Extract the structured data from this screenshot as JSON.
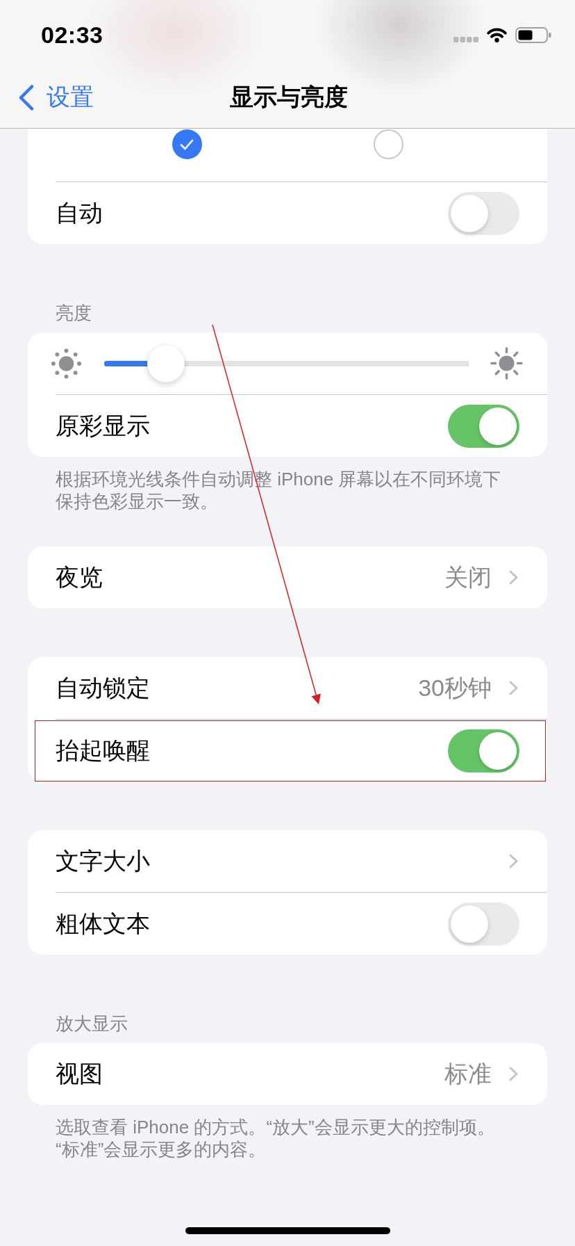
{
  "status_bar": {
    "time": "02:33"
  },
  "nav_bar": {
    "back_label": "设置",
    "title": "显示与亮度"
  },
  "groups": [
    {
      "options": [
        {
          "selected": true
        },
        {
          "selected": false
        }
      ],
      "rows": [
        {
          "kind": "toggle",
          "label": "自动",
          "on": false,
          "highlighted": false
        }
      ]
    },
    {
      "header": "亮度",
      "rows": [
        {
          "kind": "slider",
          "level": 0.17,
          "highlighted": false
        },
        {
          "kind": "toggle",
          "label": "原彩显示",
          "on": true,
          "highlighted": false
        }
      ],
      "footer": [
        "根据环境光线条件自动调整 iPhone 屏幕以在不同环境下",
        "保持色彩显示一致。"
      ]
    },
    {
      "rows": [
        {
          "kind": "link",
          "label": "夜览",
          "value": "关闭",
          "highlighted": false
        }
      ]
    },
    {
      "rows": [
        {
          "kind": "link",
          "label": "自动锁定",
          "value": "30秒钟",
          "highlighted": false
        },
        {
          "kind": "toggle",
          "label": "抬起唤醒",
          "on": true,
          "highlighted": true
        }
      ]
    },
    {
      "rows": [
        {
          "kind": "link",
          "label": "文字大小",
          "highlighted": false
        },
        {
          "kind": "toggle",
          "label": "粗体文本",
          "on": false,
          "highlighted": false
        }
      ]
    },
    {
      "header": "放大显示",
      "rows": [
        {
          "kind": "link",
          "label": "视图",
          "value": "标准",
          "highlighted": false
        }
      ],
      "footer": [
        "选取查看 iPhone 的方式。“放大”会显示更大的控制项。",
        "“标准”会显示更多的内容。"
      ]
    }
  ],
  "annotations": [
    {
      "kind": "arrow"
    }
  ]
}
